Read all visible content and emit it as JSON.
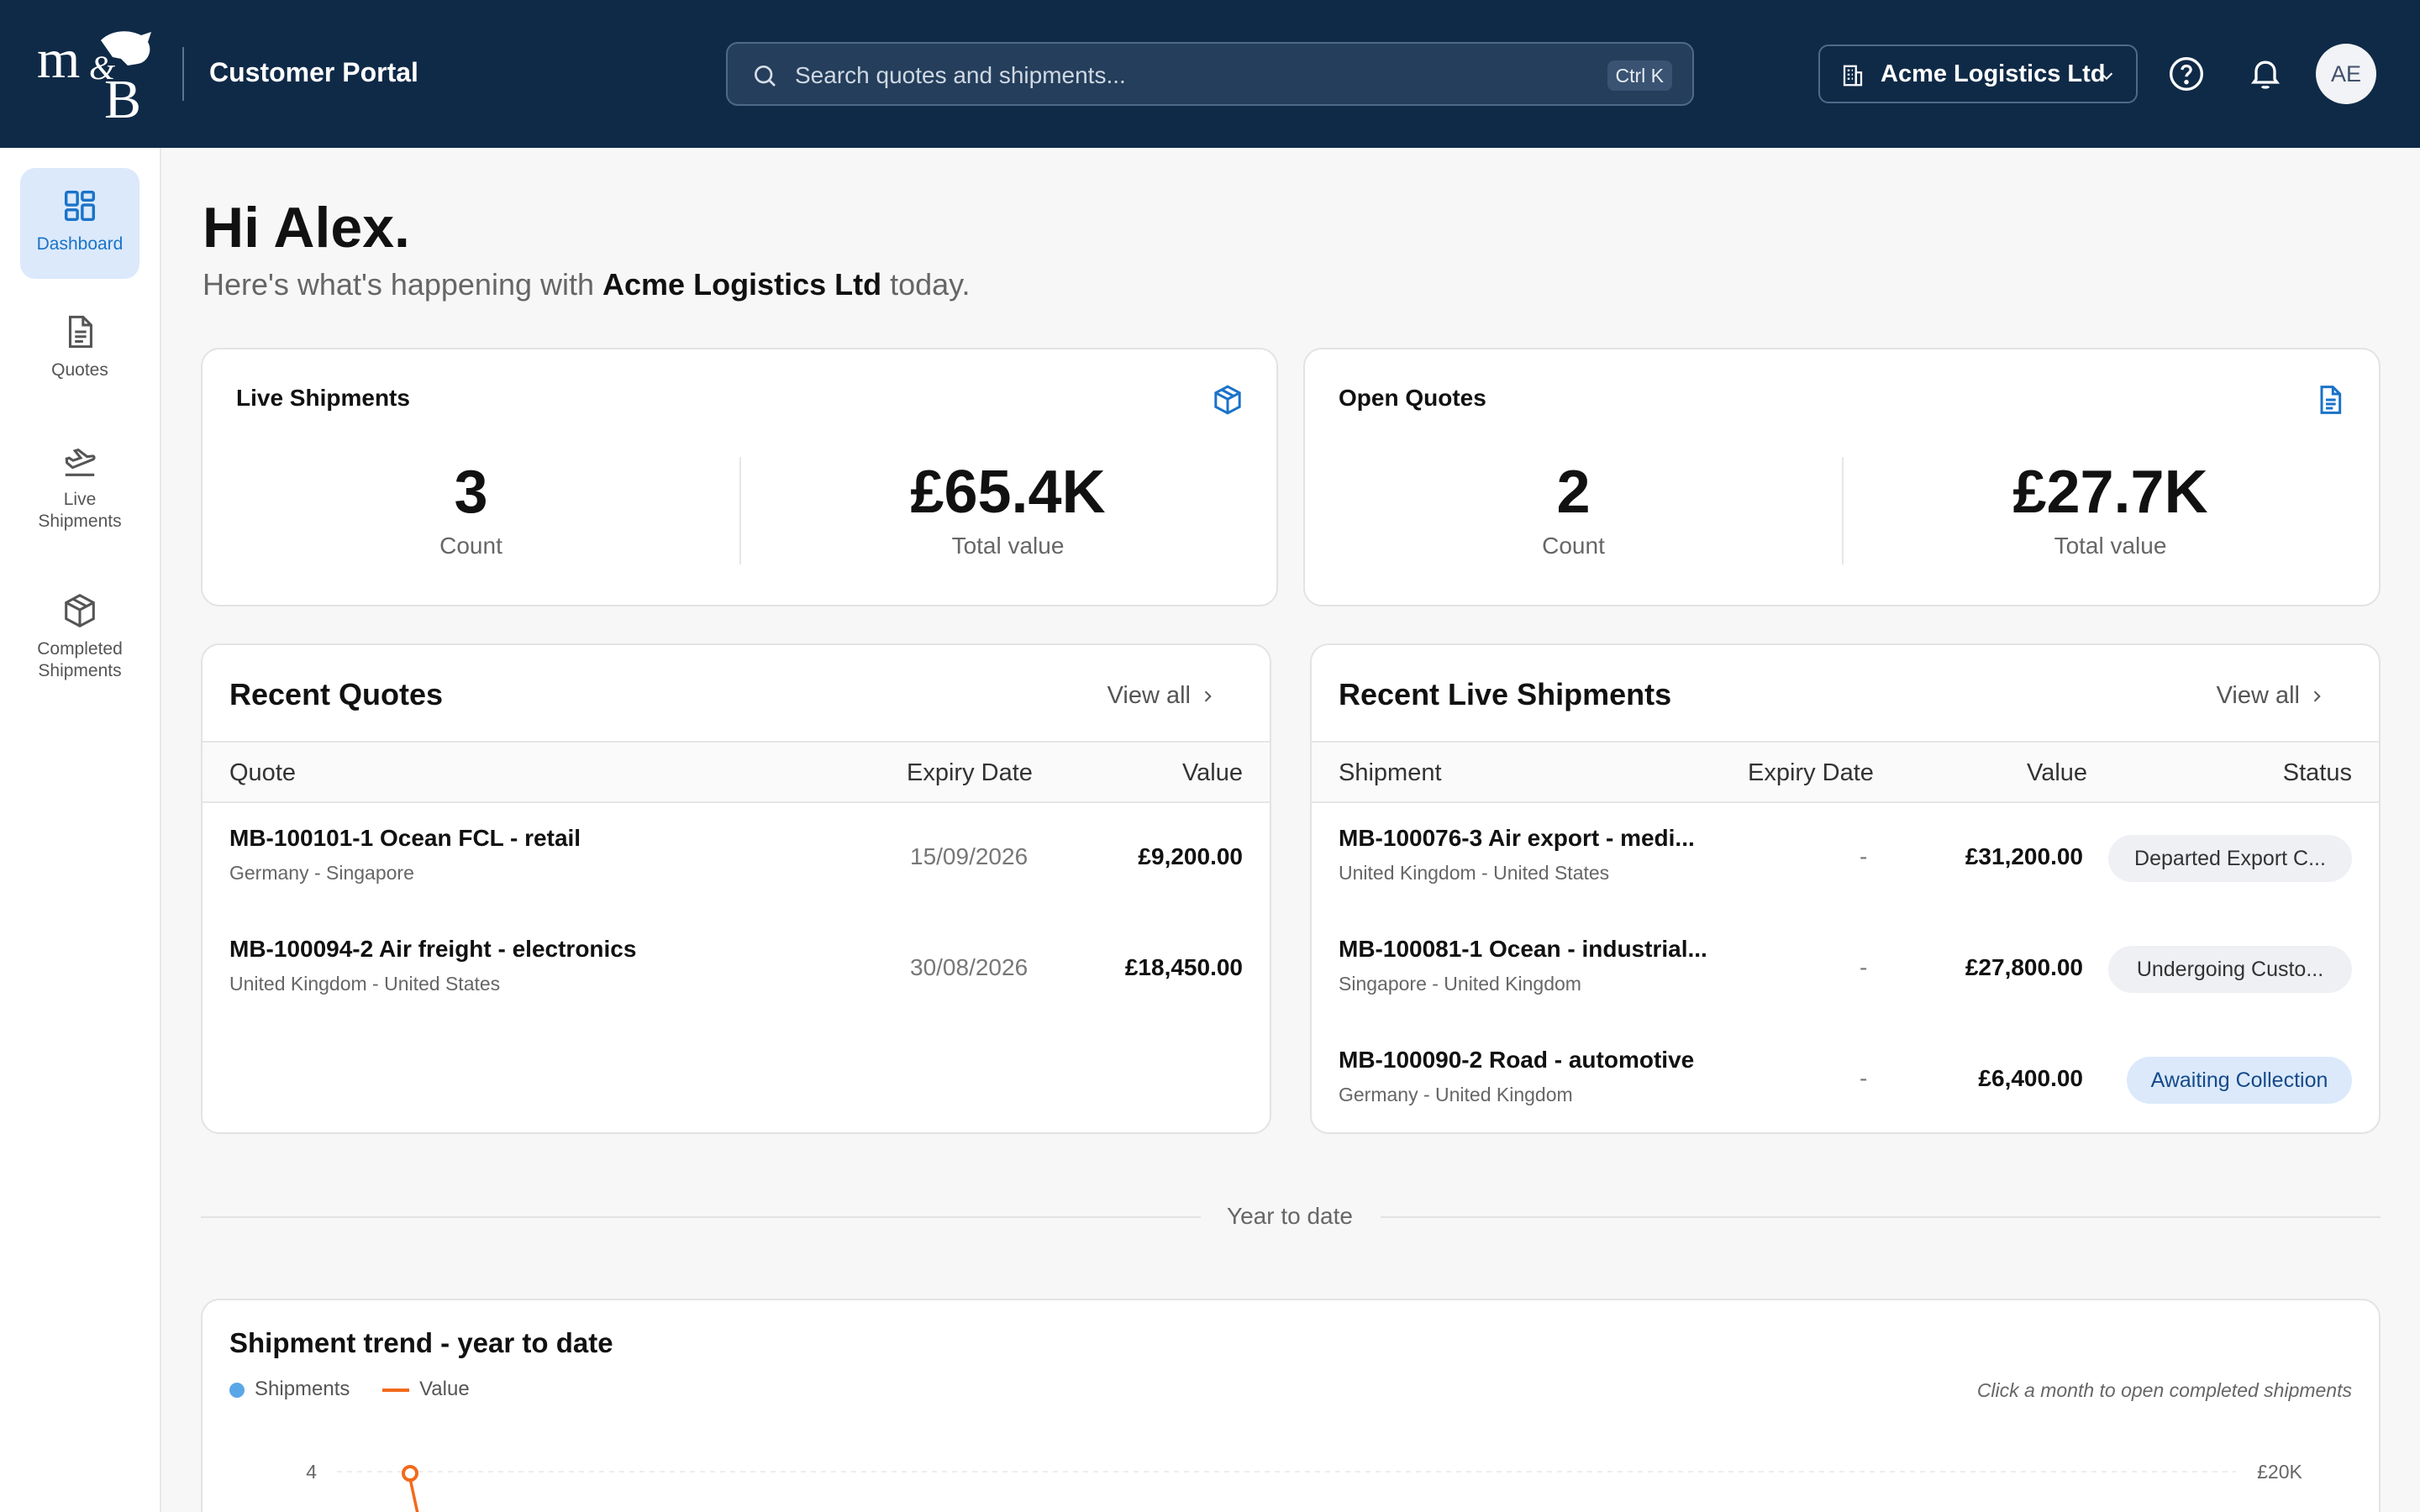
{
  "header": {
    "logo_text": "m&B",
    "portal_title": "Customer Portal",
    "search_placeholder": "Search quotes and shipments...",
    "search_shortcut": "Ctrl K",
    "company": "Acme Logistics Ltd",
    "avatar_initials": "AE",
    "colors": {
      "bar": "#0f2a47",
      "accent": "#1a73c8"
    }
  },
  "sidebar": {
    "items": [
      {
        "label": "Dashboard",
        "icon": "dashboard-grid-icon",
        "active": true
      },
      {
        "label": "Quotes",
        "icon": "document-icon"
      },
      {
        "label": "Live Shipments",
        "label_line1": "Live",
        "label_line2": "Shipments",
        "icon": "plane-departure-icon"
      },
      {
        "label": "Completed Shipments",
        "label_line1": "Completed",
        "label_line2": "Shipments",
        "icon": "package-icon"
      }
    ]
  },
  "greeting": {
    "title": "Hi Alex.",
    "sub_prefix": "Here's what's happening with",
    "sub_company": "Acme Logistics Ltd",
    "sub_suffix": "today."
  },
  "stats": {
    "live": {
      "title": "Live Shipments",
      "icon": "package-icon",
      "count": "3",
      "count_label": "Count",
      "value": "£65.4K",
      "value_label": "Total value"
    },
    "quotes": {
      "title": "Open Quotes",
      "icon": "document-icon",
      "count": "2",
      "count_label": "Count",
      "value": "£27.7K",
      "value_label": "Total value"
    }
  },
  "recent_quotes": {
    "title": "Recent Quotes",
    "view_all": "View all",
    "columns": [
      "Quote",
      "Expiry Date",
      "Value"
    ],
    "rows": [
      {
        "name": "MB-100101-1 Ocean FCL - retail",
        "route": "Germany - Singapore",
        "expiry": "15/09/2026",
        "value": "£9,200.00"
      },
      {
        "name": "MB-100094-2 Air freight - electronics",
        "route": "United Kingdom - United States",
        "expiry": "30/08/2026",
        "value": "£18,450.00"
      }
    ]
  },
  "recent_shipments": {
    "title": "Recent Live Shipments",
    "view_all": "View all",
    "columns": [
      "Shipment",
      "Expiry Date",
      "Value",
      "Status"
    ],
    "rows": [
      {
        "name": "MB-100076-3 Air export - medi...",
        "route": "United Kingdom - United States",
        "expiry": "-",
        "value": "£31,200.00",
        "status": "Departed Export C..."
      },
      {
        "name": "MB-100081-1 Ocean - industrial...",
        "route": "Singapore - United Kingdom",
        "expiry": "-",
        "value": "£27,800.00",
        "status": "Undergoing Custo..."
      },
      {
        "name": "MB-100090-2 Road - automotive",
        "route": "Germany - United Kingdom",
        "expiry": "-",
        "value": "£6,400.00",
        "status": "Awaiting Collection"
      }
    ]
  },
  "ytd_label": "Year to date",
  "chart": {
    "title": "Shipment trend - year to date",
    "hint": "Click a month to open completed shipments",
    "colors": {
      "shipments": "#5aa7e8",
      "value": "#f26a1b"
    }
  },
  "chart_data": {
    "type": "line",
    "title": "Shipment trend - year to date",
    "series": [
      {
        "name": "Shipments",
        "axis": "left"
      },
      {
        "name": "Value",
        "axis": "right",
        "visible_points": [
          4
        ]
      }
    ],
    "y_left_ticks_visible": [
      "4"
    ],
    "y_right_ticks_visible": [
      "£20K"
    ],
    "legend": "top-left",
    "grid": true
  }
}
